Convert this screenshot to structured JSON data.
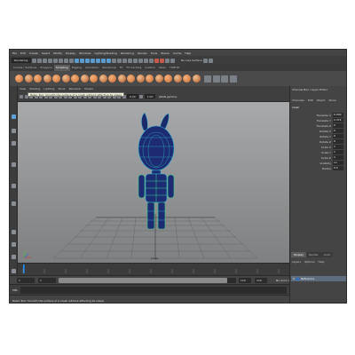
{
  "menubar": [
    "File",
    "Edit",
    "Create",
    "Select",
    "Modify",
    "Display",
    "Windows",
    "Lighting/Shading",
    "Rendering",
    "Render",
    "Tools",
    "Stereo",
    "Cache",
    "Help"
  ],
  "status": {
    "mode": "Rendering",
    "live_surface": "No Live Surface"
  },
  "shelf_tabs": [
    "Curves / Surfaces",
    "Polygons",
    "Sculpting",
    "Rigging",
    "Animation",
    "Rendering",
    "FX",
    "FX Caching",
    "Custom",
    "XGen",
    "TURTLE"
  ],
  "shelf_active_tab": "Sculpting",
  "tooltip": "Relax Tool: Smooth the surface of a mesh without affecting its shape",
  "panel_menu": [
    "View",
    "Shading",
    "Lighting",
    "Show",
    "Renderer",
    "Panels"
  ],
  "panel_fields": {
    "value_a": "0.00",
    "value_b": "1.00",
    "color_space": "sRGB gamma"
  },
  "viewport_label": "persp",
  "channel_box": {
    "title": "Channel Box / Layer Editor",
    "menu": [
      "Channels",
      "Edit",
      "Object",
      "Show"
    ],
    "object": "mesh",
    "attributes": [
      {
        "name": "Translate X",
        "value": "0.000"
      },
      {
        "name": "Translate Y",
        "value": "2.372"
      },
      {
        "name": "Translate Z",
        "value": "0"
      },
      {
        "name": "Rotate X",
        "value": "0"
      },
      {
        "name": "Rotate Y",
        "value": "0"
      },
      {
        "name": "Rotate Z",
        "value": "0"
      },
      {
        "name": "Scale X",
        "value": "1"
      },
      {
        "name": "Scale Y",
        "value": "1"
      },
      {
        "name": "Scale Z",
        "value": "1"
      },
      {
        "name": "Visibility",
        "value": "on"
      },
      {
        "name": "Radius",
        "value": "0.5"
      }
    ]
  },
  "layer_editor": {
    "tabs": [
      "Display",
      "Render",
      "Anim"
    ],
    "menu": [
      "Layers",
      "Options",
      "Help"
    ],
    "layer_flag": "V",
    "layer_name": "Reference"
  },
  "range_fields": {
    "start": "1",
    "playback_start": "1",
    "playback_end": "120",
    "end": "120",
    "current": "1"
  },
  "range_labels": {
    "anim_layer": "No Anim Layer",
    "char_set": "No Character Set"
  },
  "command_line_label": "MEL",
  "help_line": "Relax Tool: Smooth the surface of a mesh without affecting its shape"
}
